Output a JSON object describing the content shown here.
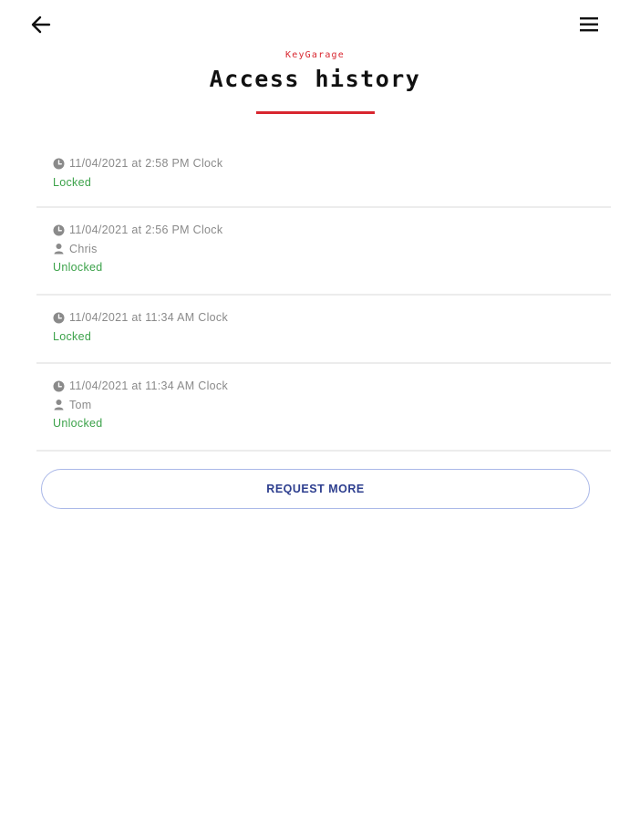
{
  "header": {
    "brand": "KeyGarage",
    "title": "Access history",
    "back_icon": "arrow-left-icon",
    "menu_icon": "hamburger-menu-icon"
  },
  "entries": [
    {
      "timestamp": "11/04/2021 at 2:58 PM Clock",
      "user": null,
      "status": "Locked"
    },
    {
      "timestamp": "11/04/2021 at 2:56 PM Clock",
      "user": "Chris",
      "status": "Unlocked"
    },
    {
      "timestamp": "11/04/2021 at 11:34 AM Clock",
      "user": null,
      "status": "Locked"
    },
    {
      "timestamp": "11/04/2021 at 11:34 AM Clock",
      "user": "Tom",
      "status": "Unlocked"
    }
  ],
  "request_more_label": "REQUEST MORE",
  "colors": {
    "brand_red": "#d8262f",
    "status_green": "#3ca24a",
    "button_blue": "#2e3f8f"
  }
}
